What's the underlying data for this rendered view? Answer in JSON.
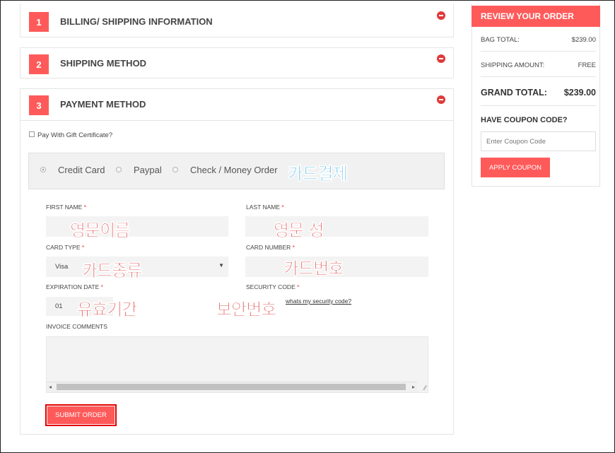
{
  "steps": [
    {
      "num": "1",
      "title": "BILLING/ SHIPPING INFORMATION"
    },
    {
      "num": "2",
      "title": "SHIPPING METHOD"
    },
    {
      "num": "3",
      "title": "PAYMENT METHOD"
    }
  ],
  "payment": {
    "gift_certificate_label": "Pay With Gift Certificate?",
    "methods": [
      "Credit Card",
      "Paypal",
      "Check / Money Order"
    ],
    "selected_method": "Credit Card",
    "method_annotation": "카드결제",
    "first_name_label": "FIRST NAME",
    "last_name_label": "LAST NAME",
    "card_type_label": "CARD TYPE",
    "card_number_label": "CARD NUMBER",
    "expiration_label": "EXPIRATION DATE",
    "security_label": "SECURITY CODE",
    "required_mark": "*",
    "card_type_value": "Visa",
    "expiration_month": "01",
    "security_link": "whats my security code?",
    "invoice_label": "INVOICE COMMENTS",
    "submit_label": "SUBMIT ORDER",
    "annotations": {
      "first_name": "영문이름",
      "last_name": "영문 성",
      "card_type": "카드종류",
      "card_number": "카드번호",
      "expiration": "유효기간",
      "security": "보안번호"
    }
  },
  "summary": {
    "title": "REVIEW YOUR ORDER",
    "bag_total_label": "BAG TOTAL:",
    "bag_total_value": "$239.00",
    "shipping_label": "SHIPPING AMOUNT:",
    "shipping_value": "FREE",
    "grand_total_label": "GRAND TOTAL:",
    "grand_total_value": "$239.00",
    "coupon_heading": "HAVE COUPON CODE?",
    "coupon_placeholder": "Enter Coupon Code",
    "apply_label": "APPLY COUPON"
  },
  "colors": {
    "accent": "#ff5a5a",
    "annotation_red": "#d81414",
    "annotation_blue": "#1aa3d6",
    "highlight_border": "#e00000"
  }
}
